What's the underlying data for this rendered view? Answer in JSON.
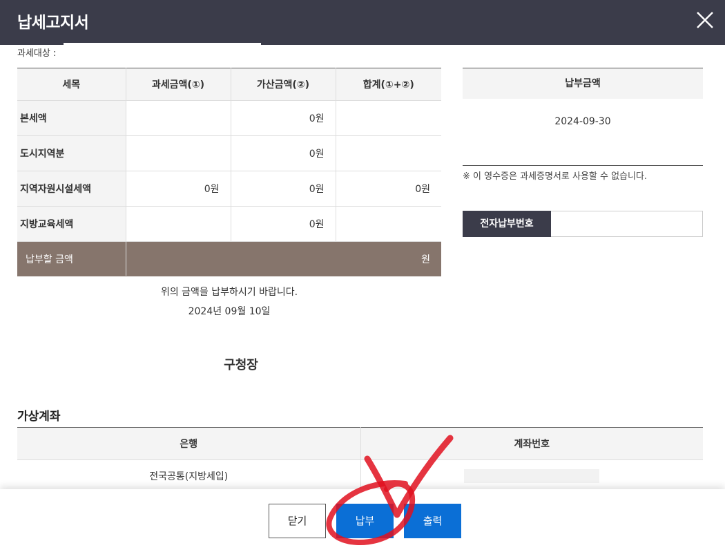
{
  "header": {
    "title": "납세고지서"
  },
  "subject": {
    "label": "과세대상 :"
  },
  "tax_table": {
    "headers": [
      "세목",
      "과세금액(①)",
      "가산금액(②)",
      "합계(①+②)"
    ],
    "rows": [
      {
        "label": "본세액",
        "taxable": "",
        "additional": "0원",
        "total": ""
      },
      {
        "label": "도시지역분",
        "taxable": "",
        "additional": "0원",
        "total": ""
      },
      {
        "label": "지역자원시설세액",
        "taxable": "0원",
        "additional": "0원",
        "total": "0원"
      },
      {
        "label": "지방교육세액",
        "taxable": "",
        "additional": "0원",
        "total": ""
      }
    ],
    "total_row": {
      "label": "납부할 금액",
      "amount": "원"
    }
  },
  "payment": {
    "heading": "납부금액",
    "date": "2024-09-30"
  },
  "notice": "※ 이 영수증은 과세증명서로 사용할 수 없습니다.",
  "electronic_payment": {
    "label": "전자납부번호",
    "value": ""
  },
  "message": {
    "line1": "위의 금액을 납부하시기 바랍니다.",
    "date": "2024년 09월 10일"
  },
  "signer": "구청장",
  "virtual_account": {
    "title": "가상계좌",
    "headers": [
      "은행",
      "계좌번호"
    ],
    "rows": [
      {
        "bank": "전국공통(지방세입)",
        "account": ""
      }
    ]
  },
  "buttons": {
    "close": "닫기",
    "pay": "납부",
    "print": "출력"
  },
  "colors": {
    "header_bg": "#3b3c4a",
    "total_row_bg": "#86756c",
    "primary_button": "#0b6fd6",
    "annotation": "#e0101e"
  }
}
